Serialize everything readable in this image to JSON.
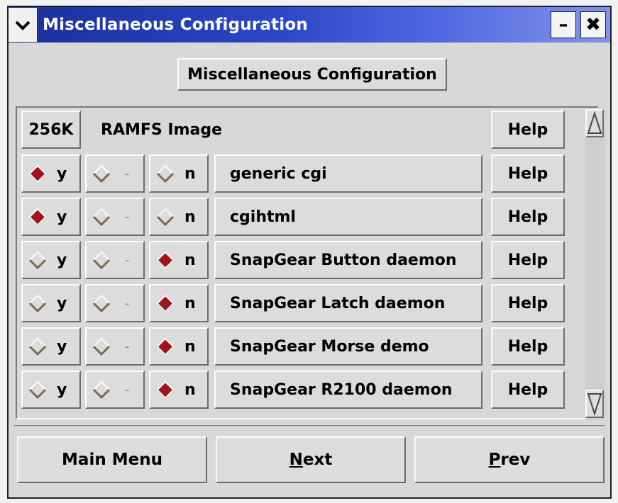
{
  "window": {
    "title": "Miscellaneous Configuration",
    "menu_icon": "chevron-down-icon",
    "minimize_label": "–",
    "close_label": "✖"
  },
  "header_button": "Miscellaneous Configuration",
  "first_row": {
    "size_label": "256K",
    "label": "RAMFS Image",
    "help": "Help"
  },
  "options": [
    {
      "label": "generic cgi",
      "y": "y",
      "m": "-",
      "n": "n",
      "selected": "y",
      "help": "Help"
    },
    {
      "label": "cgihtml",
      "y": "y",
      "m": "-",
      "n": "n",
      "selected": "y",
      "help": "Help"
    },
    {
      "label": "SnapGear Button daemon",
      "y": "y",
      "m": "-",
      "n": "n",
      "selected": "n",
      "help": "Help"
    },
    {
      "label": "SnapGear Latch daemon",
      "y": "y",
      "m": "-",
      "n": "n",
      "selected": "n",
      "help": "Help"
    },
    {
      "label": "SnapGear Morse demo",
      "y": "y",
      "m": "-",
      "n": "n",
      "selected": "n",
      "help": "Help"
    },
    {
      "label": "SnapGear R2100 daemon",
      "y": "y",
      "m": "-",
      "n": "n",
      "selected": "n",
      "help": "Help"
    }
  ],
  "buttons": {
    "main_menu": "Main Menu",
    "next_first": "N",
    "next_rest": "ext",
    "prev_first": "P",
    "prev_rest": "rev"
  },
  "colors": {
    "selected_diamond": "#a0141e",
    "titlebar": "#2c47c8"
  }
}
